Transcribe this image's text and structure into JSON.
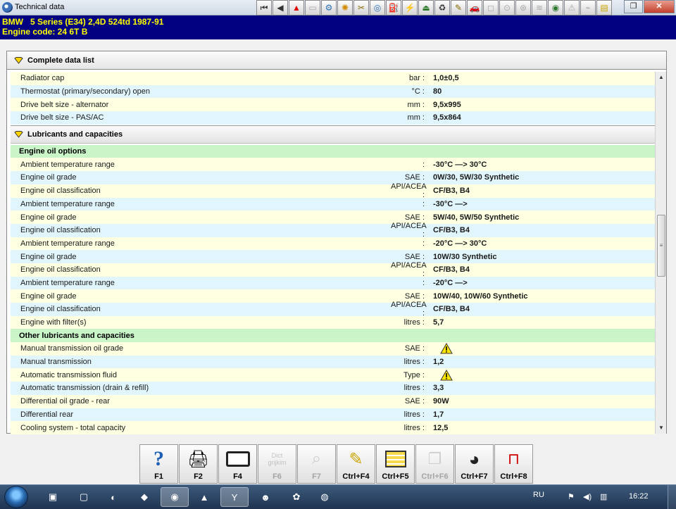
{
  "window": {
    "title": "Technical data"
  },
  "vehicle": {
    "line1": "BMW   5 Series (E34) 2,4D 524td 1987-91",
    "line2": "Engine code: 24 6T B"
  },
  "section_main": {
    "title": "Complete data list"
  },
  "top_rows": [
    {
      "label": "Radiator cap",
      "unit": "bar :",
      "value": "1,0±0,5"
    },
    {
      "label": "Thermostat (primary/secondary) open",
      "unit": "°C :",
      "value": "80"
    },
    {
      "label": "Drive belt size - alternator",
      "unit": "mm :",
      "value": "9,5x995"
    },
    {
      "label": "Drive belt size - PAS/AC",
      "unit": "mm :",
      "value": "9,5x864"
    }
  ],
  "section_lubricants": {
    "title": "Lubricants and capacities"
  },
  "group_engine_oil": {
    "title": "Engine oil options"
  },
  "engine_oil_rows": [
    {
      "label": "Ambient temperature range",
      "unit": ":",
      "value": "-30°C —> 30°C"
    },
    {
      "label": "Engine oil grade",
      "unit": "SAE :",
      "value": "0W/30, 5W/30 Synthetic"
    },
    {
      "label": "Engine oil classification",
      "unit": "API/ACEA :",
      "value": "CF/B3, B4"
    },
    {
      "label": "Ambient temperature range",
      "unit": ":",
      "value": "-30°C —>"
    },
    {
      "label": "Engine oil grade",
      "unit": "SAE :",
      "value": "5W/40, 5W/50 Synthetic"
    },
    {
      "label": "Engine oil classification",
      "unit": "API/ACEA :",
      "value": "CF/B3, B4"
    },
    {
      "label": "Ambient temperature range",
      "unit": ":",
      "value": "-20°C —> 30°C"
    },
    {
      "label": "Engine oil grade",
      "unit": "SAE :",
      "value": "10W/30 Synthetic"
    },
    {
      "label": "Engine oil classification",
      "unit": "API/ACEA :",
      "value": "CF/B3, B4"
    },
    {
      "label": "Ambient temperature range",
      "unit": ":",
      "value": "-20°C —>"
    },
    {
      "label": "Engine oil grade",
      "unit": "SAE :",
      "value": "10W/40, 10W/60 Synthetic"
    },
    {
      "label": "Engine oil classification",
      "unit": "API/ACEA :",
      "value": "CF/B3, B4"
    },
    {
      "label": "Engine with filter(s)",
      "unit": "litres :",
      "value": "5,7"
    }
  ],
  "group_other": {
    "title": "Other lubricants and capacities"
  },
  "other_rows": [
    {
      "label": "Manual transmission oil grade",
      "unit": "SAE :",
      "value": "",
      "icon": "warning-icon"
    },
    {
      "label": "Manual transmission",
      "unit": "litres :",
      "value": "1,2"
    },
    {
      "label": "Automatic transmission fluid",
      "unit": "Type :",
      "value": "",
      "icon": "warning-icon"
    },
    {
      "label": "Automatic transmission (drain & refill)",
      "unit": "litres :",
      "value": "3,3"
    },
    {
      "label": "Differential oil grade - rear",
      "unit": "SAE :",
      "value": "90W"
    },
    {
      "label": "Differential rear",
      "unit": "litres :",
      "value": "1,7"
    },
    {
      "label": "Cooling system - total capacity",
      "unit": "litres :",
      "value": "12,5"
    }
  ],
  "fkeys": [
    {
      "label": "F1",
      "icon": "help-icon",
      "enabled": true
    },
    {
      "label": "F2",
      "icon": "printer-icon",
      "enabled": true
    },
    {
      "label": "F4",
      "icon": "monitor-icon",
      "enabled": true
    },
    {
      "label": "F6",
      "icon": "dictionary-icon",
      "icon_text": "Dict\ngrijkim",
      "enabled": false
    },
    {
      "label": "F7",
      "icon": "magnifier-icon",
      "enabled": false
    },
    {
      "label": "Ctrl+F4",
      "icon": "notes-icon",
      "enabled": true
    },
    {
      "label": "Ctrl+F5",
      "icon": "table-pointer-icon",
      "enabled": true
    },
    {
      "label": "Ctrl+F6",
      "icon": "pages-icon",
      "enabled": false
    },
    {
      "label": "Ctrl+F7",
      "icon": "gauges-icon",
      "enabled": true
    },
    {
      "label": "Ctrl+F8",
      "icon": "car-lift-icon",
      "enabled": true
    }
  ],
  "taskbar": {
    "language": "RU",
    "time": "16:22"
  },
  "colors": {
    "vehicle_bg": "#000080",
    "vehicle_text": "#ffff00",
    "row_yellow": "#ffffe1",
    "row_blue": "#e1f6fc",
    "group_green": "#c9f5c9"
  }
}
